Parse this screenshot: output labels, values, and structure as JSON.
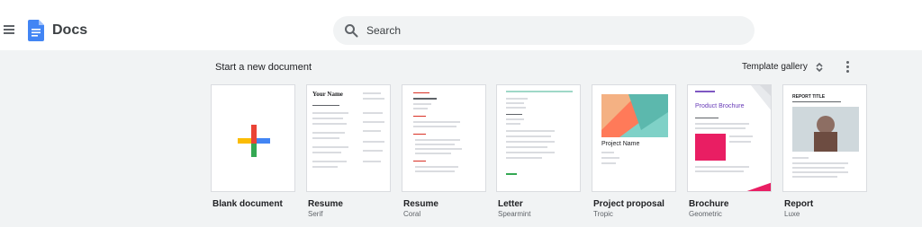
{
  "app": {
    "name": "Docs"
  },
  "search": {
    "placeholder": "Search"
  },
  "section": {
    "title": "Start a new document"
  },
  "gallery": {
    "label": "Template gallery"
  },
  "templates": [
    {
      "label": "Blank document",
      "sub": ""
    },
    {
      "label": "Resume",
      "sub": "Serif",
      "heading": "Your Name"
    },
    {
      "label": "Resume",
      "sub": "Coral"
    },
    {
      "label": "Letter",
      "sub": "Spearmint"
    },
    {
      "label": "Project proposal",
      "sub": "Tropic",
      "heading": "Project Name"
    },
    {
      "label": "Brochure",
      "sub": "Geometric",
      "heading": "Product Brochure"
    },
    {
      "label": "Report",
      "sub": "Luxe",
      "heading": "REPORT TITLE"
    }
  ],
  "icons": {
    "menu": "menu-icon",
    "logo": "docs-logo-icon",
    "search": "search-icon",
    "unfold": "unfold-more-icon",
    "more": "more-vertical-icon",
    "plus": "plus-icon"
  },
  "colors": {
    "docs_blue": "#4285f4",
    "band": "#f1f3f4",
    "plus_red": "#ea4335",
    "plus_yellow": "#fbbc04",
    "plus_green": "#34a853",
    "plus_blue": "#4285f4"
  }
}
